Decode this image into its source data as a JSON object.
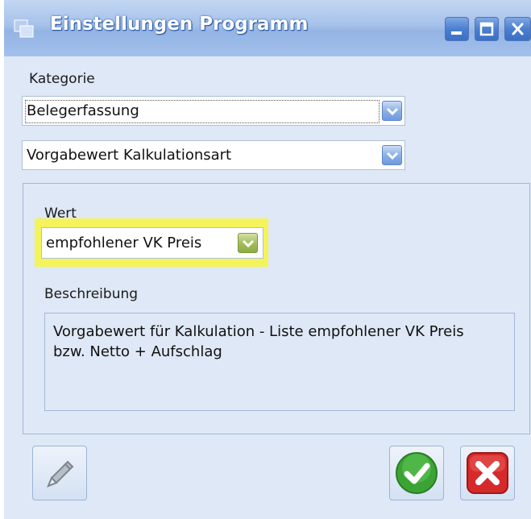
{
  "window": {
    "title": "Einstellungen Programm",
    "controls": [
      "minimize-icon",
      "maximize-icon",
      "close-icon"
    ]
  },
  "kategorie": {
    "label": "Kategorie",
    "category_value": "Belegerfassung",
    "setting_value": "Vorgabewert Kalkulationsart"
  },
  "wert": {
    "label": "Wert",
    "value": "empfohlener VK Preis",
    "highlight_color": "#f4f45a"
  },
  "beschreibung": {
    "label": "Beschreibung",
    "text": "Vorgabewert für Kalkulation - Liste empfohlener VK Preis\nbzw. Netto + Aufschlag"
  },
  "buttons": {
    "edit": "pencil-icon",
    "ok": "check-icon",
    "cancel": "x-icon"
  },
  "colors": {
    "titlebar": "#a5c1ea",
    "background": "#dfe8f6",
    "ok_green": "#3aa334",
    "cancel_red": "#d62a2a"
  }
}
